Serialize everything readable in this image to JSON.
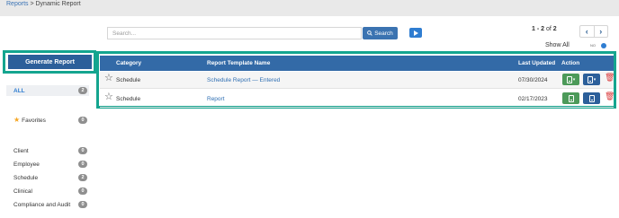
{
  "breadcrumb": {
    "link": "Reports",
    "separator": " > ",
    "current": "Dynamic Report"
  },
  "search": {
    "placeholder": "Search...",
    "value": "",
    "button_label": "Search"
  },
  "pager": {
    "range": "1 - 2",
    "of_label": "of",
    "total": "2",
    "prev_icon": "‹",
    "next_icon": "›"
  },
  "show_all": {
    "label": "Show All",
    "toggle_text": "NO"
  },
  "sidebar": {
    "generate_label": "Generate Report",
    "filters": [
      {
        "label": "ALL",
        "count": "2",
        "active": true
      },
      {
        "label": "Favorites",
        "count": "0",
        "icon": "star-icon"
      },
      {
        "label": "Client",
        "count": "0"
      },
      {
        "label": "Employee",
        "count": "0"
      },
      {
        "label": "Schedule",
        "count": "2"
      },
      {
        "label": "Clinical",
        "count": "0"
      },
      {
        "label": "Compliance and Audit",
        "count": "0"
      }
    ]
  },
  "table": {
    "columns": [
      "Category",
      "Report Template Name",
      "Last Updated",
      "Action"
    ],
    "rows": [
      {
        "category": "Schedule",
        "name": "Schedule Report — Entered",
        "updated": "07/30/2024"
      },
      {
        "category": "Schedule",
        "name": "Report",
        "updated": "02/17/2023"
      }
    ]
  },
  "colors": {
    "header_blue": "#336aa7",
    "highlight": "#14a58f",
    "green_action": "#4c9a59",
    "delete_red": "#d9383a"
  }
}
